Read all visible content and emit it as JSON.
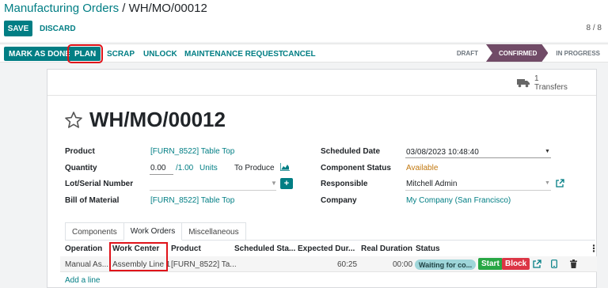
{
  "breadcrumb": {
    "parent": "Manufacturing Orders",
    "separator": " / ",
    "current": "WH/MO/00012"
  },
  "toolbar": {
    "save_label": "SAVE",
    "discard_label": "DISCARD",
    "pager": "8 / 8"
  },
  "actions": {
    "mark_done": "MARK AS DONE",
    "plan": "PLAN",
    "scrap": "SCRAP",
    "unlock": "UNLOCK",
    "maintenance": "MAINTENANCE REQUEST",
    "cancel": "CANCEL"
  },
  "status_stages": {
    "draft": "DRAFT",
    "confirmed": "CONFIRMED",
    "in_progress": "IN PROGRESS"
  },
  "smart_button": {
    "count": "1",
    "label": "Transfers"
  },
  "title": "WH/MO/00012",
  "fields": {
    "product_label": "Product",
    "product_value": "[FURN_8522] Table Top",
    "quantity_label": "Quantity",
    "quantity_value": "0.00",
    "quantity_total": "/1.00",
    "quantity_unit": "Units",
    "to_produce": "To Produce",
    "lot_label": "Lot/Serial Number",
    "bom_label": "Bill of Material",
    "bom_value": "[FURN_8522] Table Top",
    "scheduled_label": "Scheduled Date",
    "scheduled_value": "03/08/2023 10:48:40",
    "component_status_label": "Component Status",
    "component_status_value": "Available",
    "responsible_label": "Responsible",
    "responsible_value": "Mitchell Admin",
    "company_label": "Company",
    "company_value": "My Company (San Francisco)"
  },
  "tabs": [
    "Components",
    "Work Orders",
    "Miscellaneous"
  ],
  "table": {
    "headers": [
      "Operation",
      "Work Center",
      "Product",
      "Scheduled Sta...",
      "Expected Dur...",
      "Real Duration",
      "Status"
    ],
    "row": {
      "operation": "Manual As...",
      "work_center": "Assembly Line 1",
      "product": "[FURN_8522] Ta...",
      "expected": "60:25",
      "real": "00:00",
      "status": "Waiting for co...",
      "start": "Start",
      "block": "Block"
    },
    "add_line": "Add a line"
  },
  "colors": {
    "primary": "#017e84",
    "stage_active": "#714b67",
    "highlight": "#e0131a",
    "start": "#28a745",
    "block": "#dc3545"
  },
  "icons": [
    "star-icon",
    "truck-icon",
    "chart-icon",
    "plus-square-icon",
    "external-link-icon",
    "dropdown-caret-icon",
    "phone-icon",
    "trash-icon",
    "kebab-icon"
  ]
}
